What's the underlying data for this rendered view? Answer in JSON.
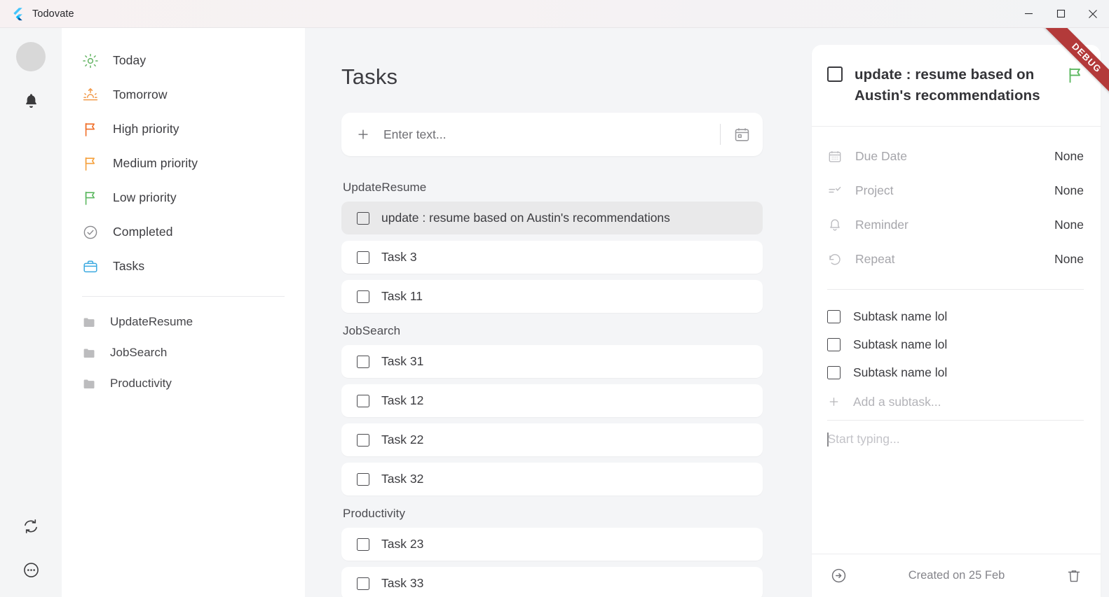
{
  "window": {
    "title": "Todovate",
    "logo_icon": "flutter-logo",
    "minimize_icon": "minimize-icon",
    "maximize_icon": "maximize-icon",
    "close_icon": "close-icon"
  },
  "debug_banner": {
    "label": "DEBUG",
    "color": "#b33a3a"
  },
  "rail": {
    "avatar_icon": "avatar-placeholder",
    "notifications_icon": "bell-icon",
    "sync_icon": "sync-icon",
    "more_icon": "more-options-icon"
  },
  "sidebar": {
    "items": [
      {
        "label": "Today",
        "icon": "sun-icon",
        "color": "#64b464"
      },
      {
        "label": "Tomorrow",
        "icon": "sunrise-icon",
        "color": "#f29a4a"
      },
      {
        "label": "High priority",
        "icon": "flag-icon",
        "color": "#f06e28"
      },
      {
        "label": "Medium priority",
        "icon": "flag-icon",
        "color": "#f5a03c"
      },
      {
        "label": "Low priority",
        "icon": "flag-icon",
        "color": "#5cb860"
      },
      {
        "label": "Completed",
        "icon": "check-circle-icon",
        "color": "#8a8a8e"
      },
      {
        "label": "Tasks",
        "icon": "briefcase-icon",
        "color": "#3aa9e0"
      }
    ],
    "projects": [
      {
        "label": "UpdateResume",
        "icon": "folder-icon"
      },
      {
        "label": "JobSearch",
        "icon": "folder-icon"
      },
      {
        "label": "Productivity",
        "icon": "folder-icon"
      }
    ]
  },
  "main": {
    "title": "Tasks",
    "add_task": {
      "plus_icon": "plus-icon",
      "value": "",
      "placeholder": "Enter text...",
      "calendar_icon": "calendar-icon"
    },
    "groups": [
      {
        "name": "UpdateResume",
        "tasks": [
          {
            "label": "update : resume based on Austin's recommendations",
            "selected": true,
            "checked": false
          },
          {
            "label": "Task 3",
            "selected": false,
            "checked": false
          },
          {
            "label": "Task 11",
            "selected": false,
            "checked": false
          }
        ]
      },
      {
        "name": "JobSearch",
        "tasks": [
          {
            "label": "Task 31",
            "selected": false,
            "checked": false
          },
          {
            "label": "Task 12",
            "selected": false,
            "checked": false
          },
          {
            "label": "Task 22",
            "selected": false,
            "checked": false
          },
          {
            "label": "Task 32",
            "selected": false,
            "checked": false
          }
        ]
      },
      {
        "name": "Productivity",
        "tasks": [
          {
            "label": "Task 23",
            "selected": false,
            "checked": false
          },
          {
            "label": "Task 33",
            "selected": false,
            "checked": false
          }
        ]
      }
    ]
  },
  "detail": {
    "title": "update : resume based on Austin's recommendations",
    "checked": false,
    "flag_icon": "flag-icon",
    "flag_color": "#5cb860",
    "properties": [
      {
        "label": "Due Date",
        "value": "None",
        "icon": "calendar-icon"
      },
      {
        "label": "Project",
        "value": "None",
        "icon": "project-list-icon"
      },
      {
        "label": "Reminder",
        "value": "None",
        "icon": "bell-icon"
      },
      {
        "label": "Repeat",
        "value": "None",
        "icon": "repeat-icon"
      }
    ],
    "subtasks": [
      {
        "label": "Subtask name lol",
        "checked": false
      },
      {
        "label": "Subtask name lol",
        "checked": false
      },
      {
        "label": "Subtask name lol",
        "checked": false
      }
    ],
    "add_subtask": {
      "placeholder": "Add a subtask...",
      "plus_icon": "plus-icon"
    },
    "note": {
      "value": "",
      "placeholder": "Start typing..."
    },
    "footer": {
      "move_icon": "arrow-right-circle-icon",
      "created_text": "Created on 25 Feb",
      "delete_icon": "trash-icon"
    }
  }
}
